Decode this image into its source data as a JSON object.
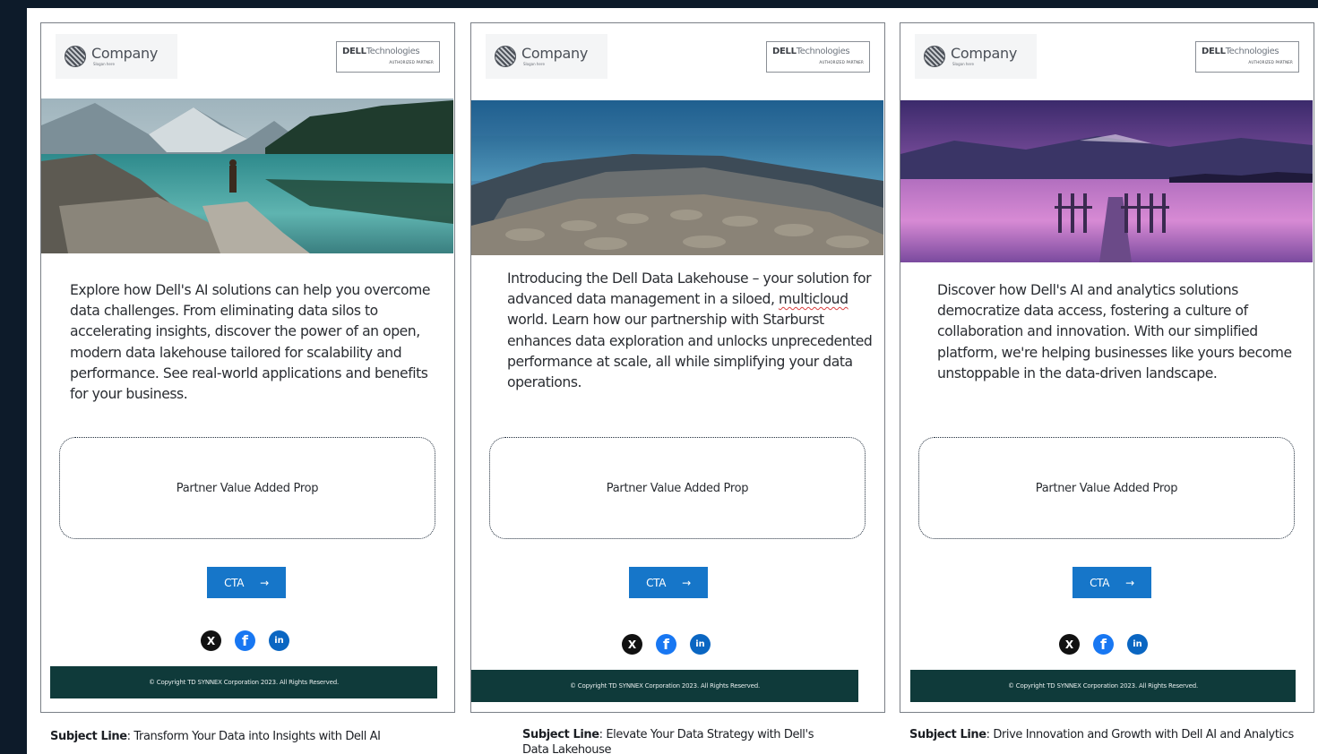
{
  "cards": [
    {
      "logo_text": "Company",
      "logo_tagline": "Slogan here",
      "badge_brand": "DELL",
      "badge_word": "Technologies",
      "badge_sub": "AUTHORIZED PARTNER",
      "body": "Explore how Dell's AI solutions can help you overcome data challenges. From eliminating data silos to accelerating insights, discover the power of an open, modern data lakehouse tailored for scalability and performance. See real-world applications and benefits for your business.",
      "value_prop": "Partner Value Added Prop",
      "cta_label": "CTA",
      "cta_arrow": "→",
      "footer": "© Copyright TD SYNNEX Corporation 2023. All Rights Reserved.",
      "subject_label": "Subject Line",
      "subject_text": ": Transform Your Data into Insights with Dell AI"
    },
    {
      "logo_text": "Company",
      "logo_tagline": "Slogan here",
      "badge_brand": "DELL",
      "badge_word": "Technologies",
      "badge_sub": "AUTHORIZED PARTNER",
      "body_before": "Introducing the Dell Data Lakehouse – your solution for advanced data management in a siloed, ",
      "body_flagged": "multicloud",
      "body_after": " world. Learn how our partnership with Starburst enhances data exploration and unlocks unprecedented performance at scale, all while simplifying your data operations.",
      "value_prop": "Partner Value Added Prop",
      "cta_label": "CTA",
      "cta_arrow": "→",
      "footer": "© Copyright TD SYNNEX Corporation 2023. All Rights Reserved.",
      "subject_label": "Subject Line",
      "subject_text": ": Elevate Your Data Strategy with Dell's Data Lakehouse"
    },
    {
      "logo_text": "Company",
      "logo_tagline": "Slogan here",
      "badge_brand": "DELL",
      "badge_word": "Technologies",
      "badge_sub": "AUTHORIZED PARTNER",
      "body": "Discover how Dell's AI and analytics solutions democratize data access, fostering a culture of collaboration and innovation. With our simplified platform, we're helping businesses like yours become unstoppable in the data-driven landscape.",
      "value_prop": "Partner Value Added Prop",
      "cta_label": "CTA",
      "cta_arrow": "→",
      "footer": "© Copyright TD SYNNEX Corporation 2023. All Rights Reserved.",
      "subject_label": "Subject Line",
      "subject_text": ": Drive Innovation and Growth with Dell AI and Analytics"
    }
  ],
  "social_icons": [
    "x-icon",
    "facebook-icon",
    "linkedin-icon"
  ],
  "colors": {
    "cta": "#1676c9",
    "footer": "#0f3a3a",
    "page_background": "#0d1b2a"
  }
}
